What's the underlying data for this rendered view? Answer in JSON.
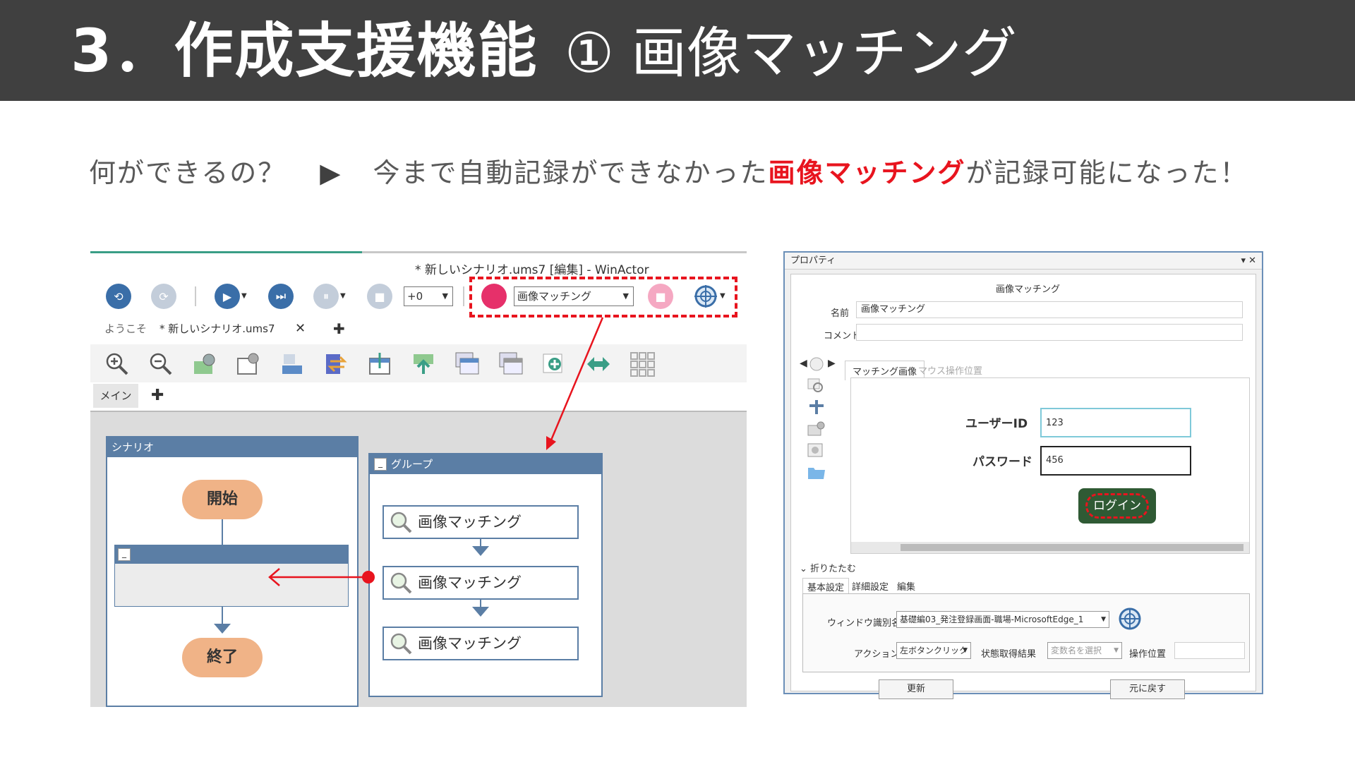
{
  "slide": {
    "title": "3．作成支援機能",
    "subtitle": "① 画像マッチング",
    "lead_question": "何ができるの？",
    "lead_arrow": "▶",
    "lead_text_before": "今まで自動記録ができなかった",
    "lead_highlight": "画像マッチング",
    "lead_text_after": "が記録可能になった！",
    "highlight_color": "#e8141e"
  },
  "winactor": {
    "window_title": "* 新しいシナリオ.ums7 [編集] - WinActor",
    "speed_value": "+0",
    "record_mode_value": "画像マッチング",
    "tabs": [
      "ようこそ",
      "* 新しいシナリオ.ums7"
    ],
    "tab_close": "✕",
    "tab_add": "✚",
    "sub_tab": "メイン",
    "sub_tab_add": "✚",
    "toolbar_icons": [
      "refresh-icon",
      "redo-icon",
      "play-icon",
      "step-icon",
      "pause-icon",
      "stop-icon",
      "record-icon",
      "record-stop-icon",
      "target-icon"
    ],
    "scenario_panel": {
      "title": "シナリオ",
      "start_label": "開始",
      "end_label": "終了",
      "group_collapse": "_"
    },
    "group_panel": {
      "title": "グループ",
      "collapse": "_",
      "actions": [
        "画像マッチング",
        "画像マッチング",
        "画像マッチング"
      ]
    }
  },
  "properties": {
    "window_title": "プロパティ",
    "window_controls": "▾ ✕",
    "node_heading": "画像マッチング",
    "name_label": "名前",
    "name_value": "画像マッチング",
    "comment_label": "コメント",
    "comment_value": "",
    "image_tabs": [
      "マッチング画像",
      "マウス操作位置"
    ],
    "preview": {
      "user_id_label": "ユーザーID",
      "user_id_value": "123",
      "password_label": "パスワード",
      "password_value": "456",
      "login_button": "ログイン"
    },
    "fold_label": "折りたたむ",
    "settings_tabs": [
      "基本設定",
      "詳細設定",
      "編集"
    ],
    "window_id_label": "ウィンドウ識別名",
    "window_id_value": "基礎編03_発注登録画面-職場-MicrosoftEdge_1",
    "action_label": "アクション",
    "action_value": "左ボタンクリック",
    "state_label": "状態取得結果",
    "state_value": "変数名を選択",
    "position_label": "操作位置",
    "position_value": "",
    "update_button": "更新",
    "revert_button": "元に戻す"
  }
}
